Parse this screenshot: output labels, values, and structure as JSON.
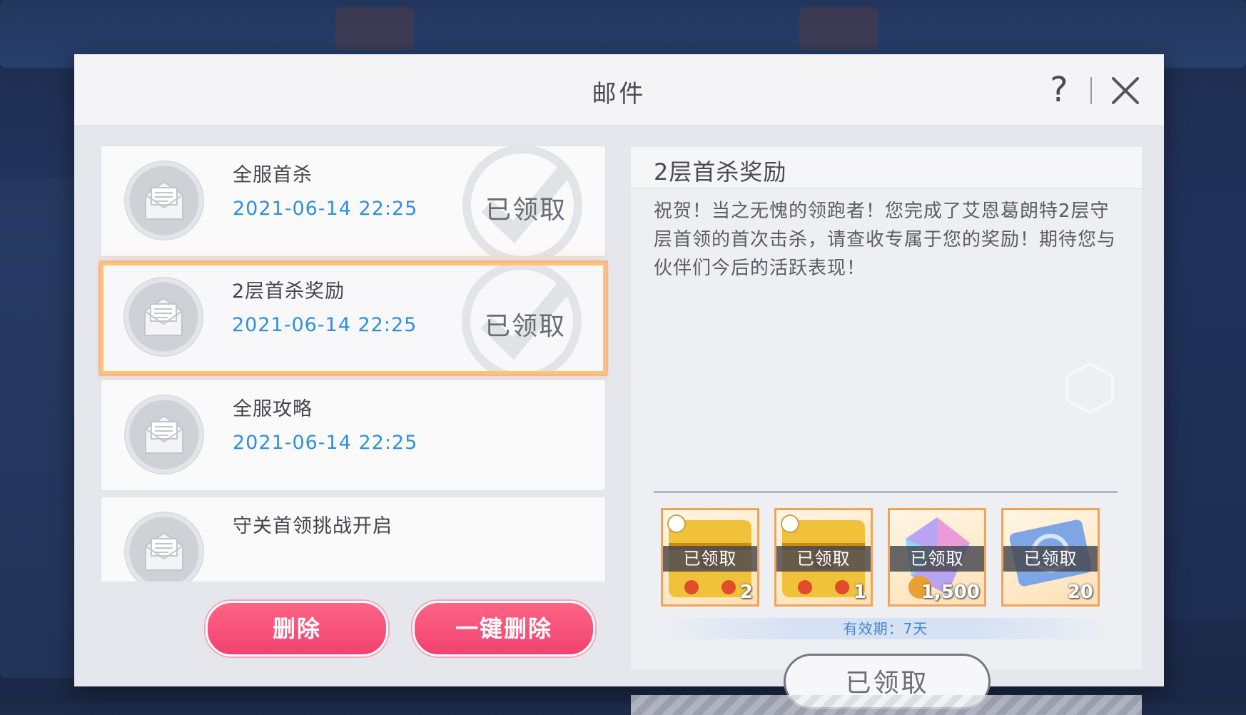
{
  "window": {
    "title": "邮件",
    "help_label": "?"
  },
  "mail_list": [
    {
      "name": "全服首杀",
      "date": "2021-06-14  22:25",
      "status": "已领取",
      "selected": false
    },
    {
      "name": "2层首杀奖励",
      "date": "2021-06-14  22:25",
      "status": "已领取",
      "selected": true
    },
    {
      "name": "全服攻略",
      "date": "2021-06-14  22:25",
      "status": "",
      "selected": false
    },
    {
      "name": "守关首领挑战开启",
      "date": "",
      "status": "",
      "selected": false
    }
  ],
  "actions": {
    "delete_label": "删除",
    "delete_all_label": "一键删除"
  },
  "detail": {
    "title": "2层首杀奖励",
    "body": "祝贺！当之无愧的领跑者！您完成了艾恩葛朗特2层守层首领的首次击杀，请查收专属于您的奖励！期待您与伙伴们今后的活跃表现！",
    "rewards": [
      {
        "item": "golden-chest",
        "status": "已领取",
        "quantity": "2"
      },
      {
        "item": "golden-chest",
        "status": "已领取",
        "quantity": "1"
      },
      {
        "item": "crystal",
        "status": "已领取",
        "quantity": "1,500"
      },
      {
        "item": "ticket",
        "status": "已领取",
        "quantity": "20"
      }
    ],
    "expiry": "有效期：7天",
    "claim_button_label": "已领取"
  },
  "colors": {
    "date_blue": "#2f8fe0",
    "delete_pink": "#f04270",
    "selected_border": "#ffc56b"
  }
}
